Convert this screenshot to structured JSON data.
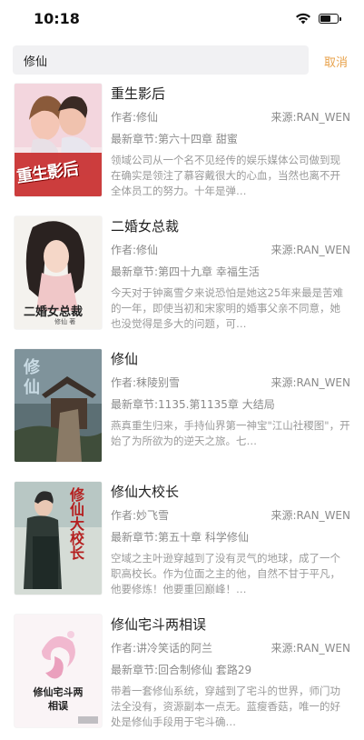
{
  "status": {
    "time": "10:18"
  },
  "search": {
    "query": "修仙",
    "cancel_label": "取消"
  },
  "books": [
    {
      "title": "重生影后",
      "author_label": "作者:修仙",
      "source": "来源:RAN_WEN",
      "latest": "最新章节:第六十四章 甜蜜",
      "desc": "领域公司从一个名不见经传的娱乐媒体公司做到现在确实是领注了慕容戴很大的心血，当然也离不开全体员工的努力。十年是弹…",
      "cover_text": "重生影后"
    },
    {
      "title": "二婚女总裁",
      "author_label": "作者:修仙",
      "source": "来源:RAN_WEN",
      "latest": "最新章节:第四十九章 幸福生活",
      "desc": "今天对于钟离雪夕来说恐怕是她这25年来最是苦难的一年，即使当初和宋家明的婚事父亲不同意，她也没觉得是多大的问题，可…",
      "cover_text": "二婚女总裁",
      "cover_sub": "修仙 著"
    },
    {
      "title": "修仙",
      "author_label": "作者:秣陵别雪",
      "source": "来源:RAN_WEN",
      "latest": "最新章节:1135.第1135章 大结局",
      "desc": "燕真重生归来，手持仙界第一神宝\"江山社稷图\"，开始了为所欲为的逆天之旅。七…",
      "cover_text": "修仙"
    },
    {
      "title": "修仙大校长",
      "author_label": "作者:妙飞雪",
      "source": "来源:RAN_WEN",
      "latest": "最新章节:第五十章 科学修仙",
      "desc": "空域之主叶逊穿越到了没有灵气的地球，成了一个职高校长。作为位面之主的他，自然不甘于平凡，他要修炼！他要重回巅峰！…",
      "cover_text": "修仙大校长"
    },
    {
      "title": "修仙宅斗两相误",
      "author_label": "作者:讲冷笑话的阿兰",
      "source": "来源:RAN_WEN",
      "latest": "最新章节:回合制修仙 套路29",
      "desc": "带着一套修仙系统，穿越到了宅斗的世界，师门功法全没有，资源副本一点无。蓝瘦香菇，唯一的好处是修仙手段用于宅斗确…",
      "cover_text": "修仙宅斗两相误"
    }
  ],
  "colors": {
    "accent": "#e8a24b"
  }
}
